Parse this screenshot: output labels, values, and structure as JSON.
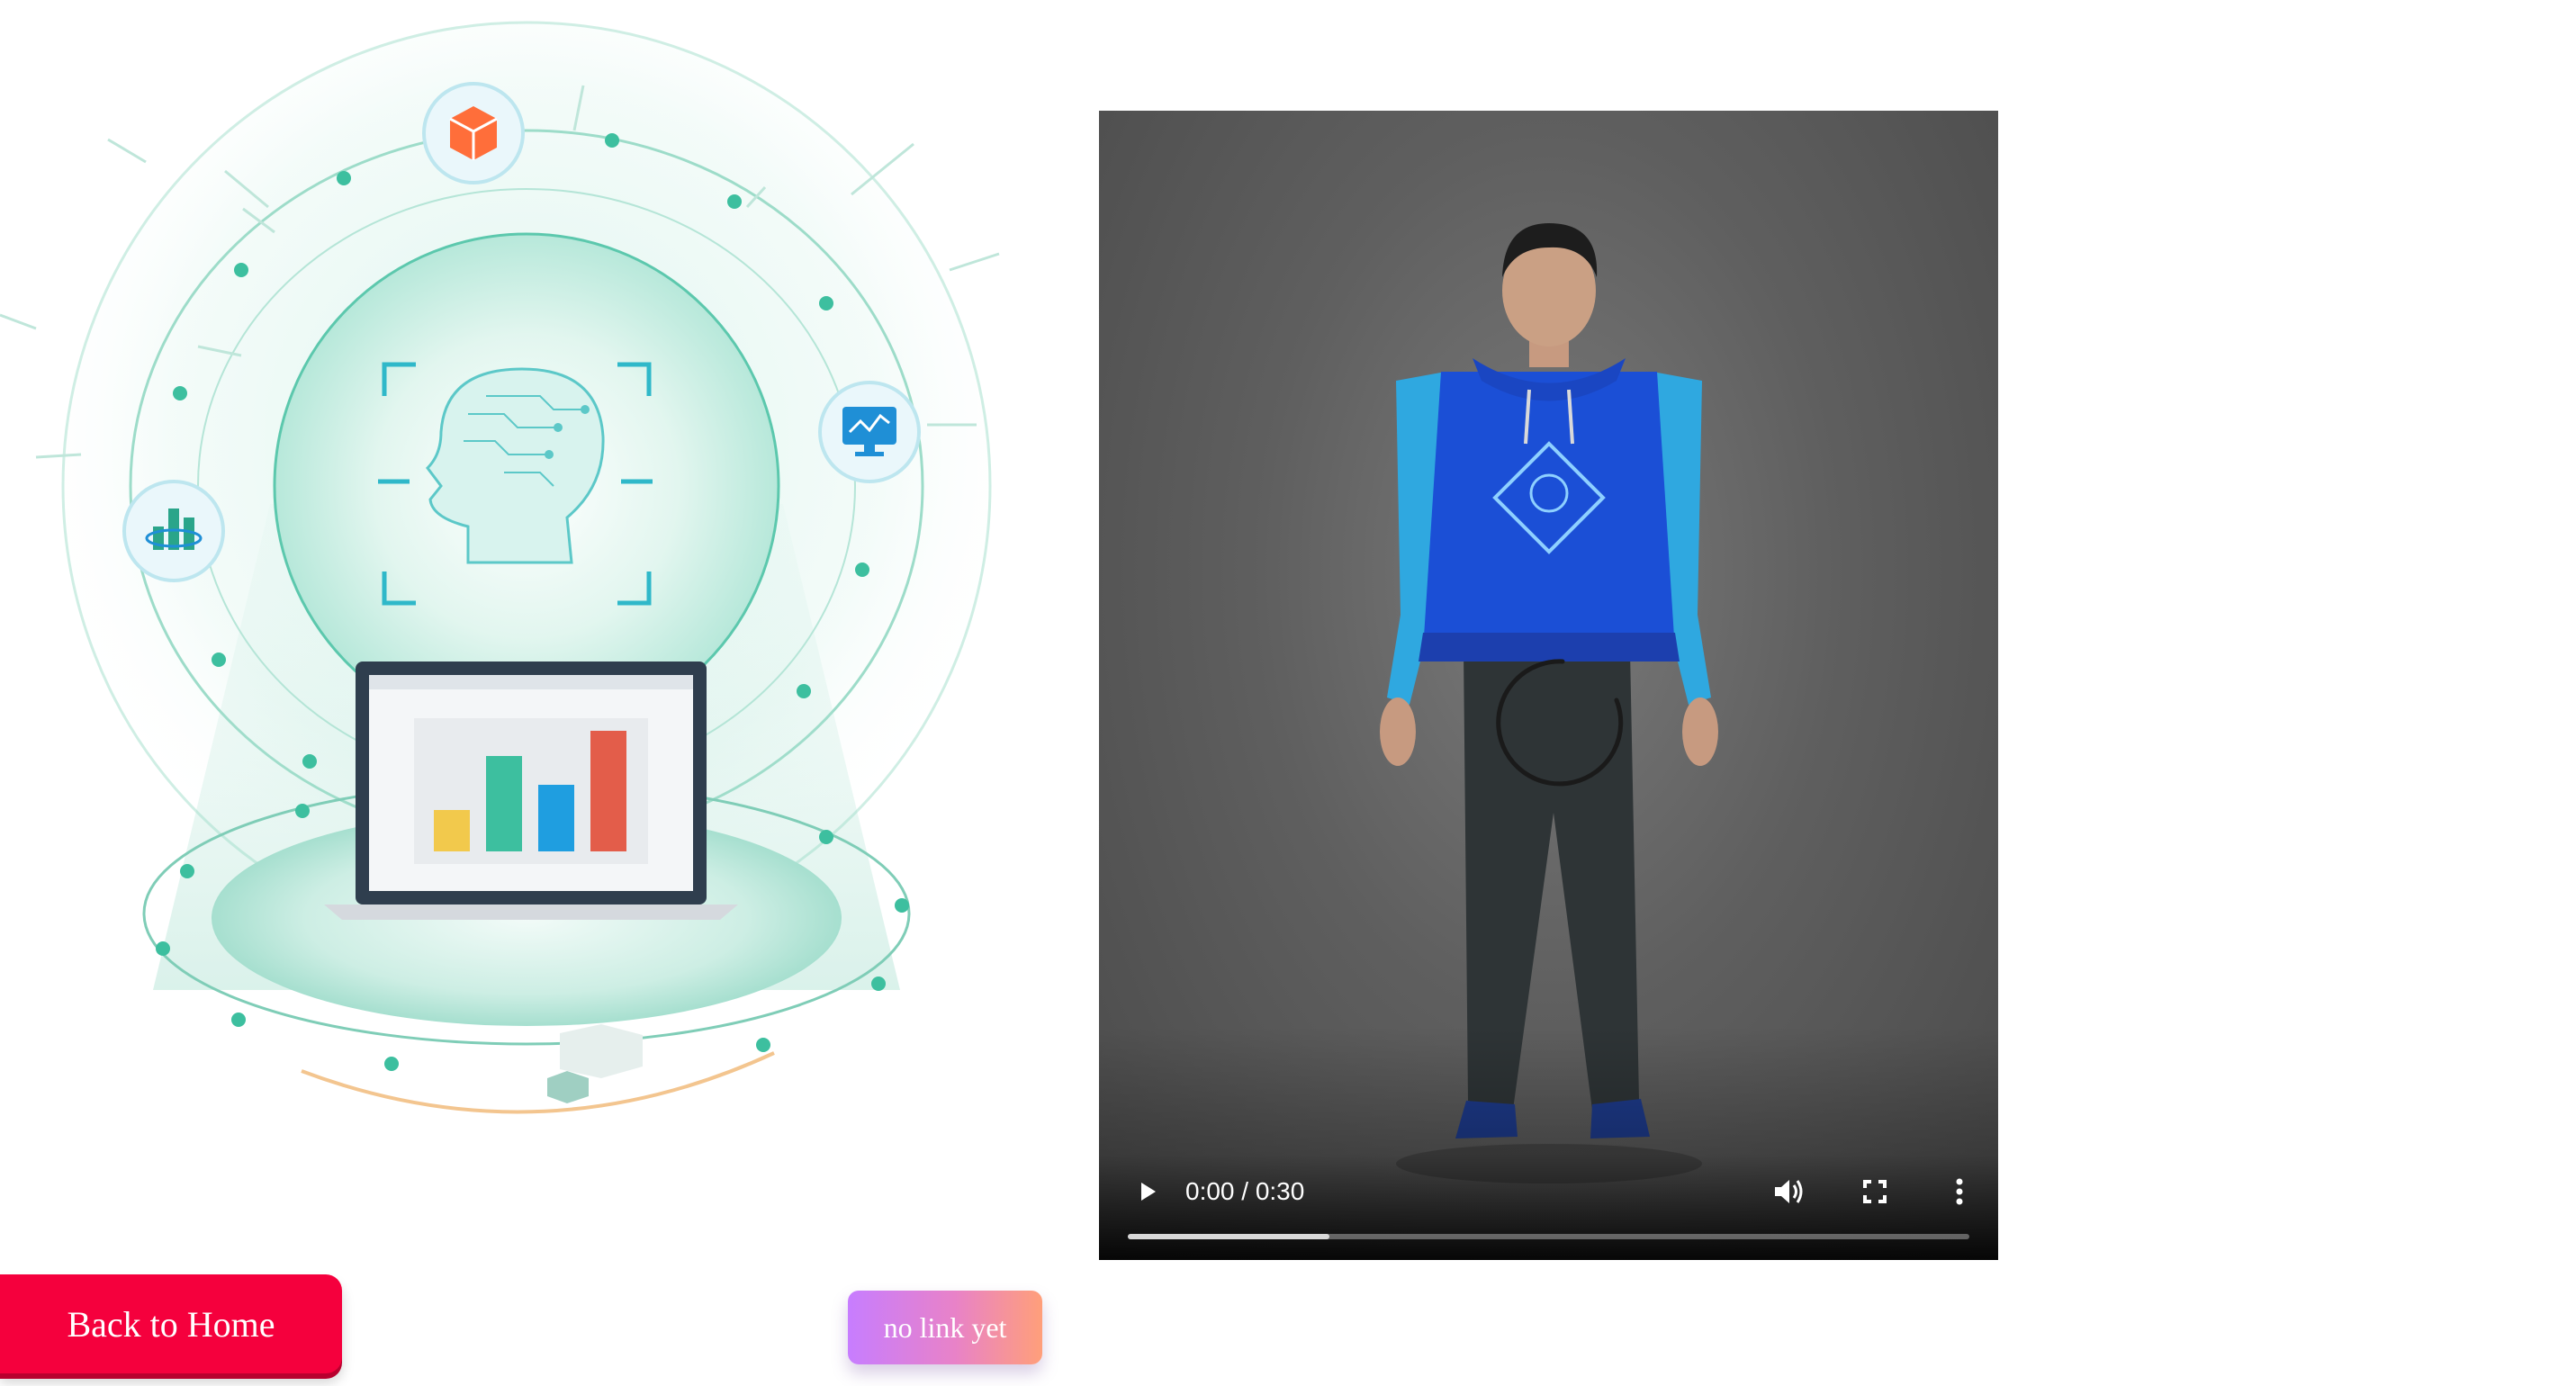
{
  "video": {
    "time_display": "0:00 / 0:30",
    "played_fraction": 0.0,
    "buffered_fraction": 0.24,
    "controls": {
      "play_icon": "play-icon",
      "volume_icon": "volume-icon",
      "fullscreen_icon": "fullscreen-icon",
      "more_icon": "more-options-icon",
      "loading_icon": "loading-spinner-icon"
    }
  },
  "illustration": {
    "icons": [
      "box-icon",
      "monitor-chart-icon",
      "bar-chart-icon",
      "brain-head-icon",
      "laptop-icon"
    ]
  },
  "buttons": {
    "back_home_label": "Back to Home",
    "no_link_label": "no link yet"
  },
  "colors": {
    "back_home_bg": "#f5003d",
    "accent_teal": "#3dbf9f",
    "gradient_start": "#c77dff",
    "gradient_end": "#ff9f7a"
  }
}
